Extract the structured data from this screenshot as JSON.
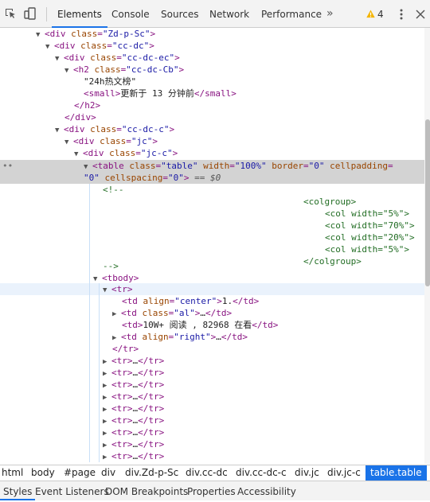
{
  "toolbar": {
    "tabs": [
      {
        "label": "Elements",
        "active": true
      },
      {
        "label": "Console"
      },
      {
        "label": "Sources"
      },
      {
        "label": "Network"
      },
      {
        "label": "Performance"
      }
    ],
    "more": "»",
    "warning_count": "4",
    "icons": [
      "inspect-icon",
      "device-toolbar-icon",
      "warning-icon",
      "kebab-menu-icon",
      "close-icon"
    ]
  },
  "dom": {
    "l1": {
      "open": "<",
      "tag": "div",
      "attr": "class",
      "val": "\"Zd-p-Sc\"",
      "close": ">"
    },
    "l2": {
      "open": "<",
      "tag": "div",
      "attr": "class",
      "val": "\"cc-dc\"",
      "close": ">"
    },
    "l3": {
      "open": "<",
      "tag": "div",
      "attr": "class",
      "val": "\"cc-dc-ec\"",
      "close": ">"
    },
    "l4": {
      "open": "<",
      "tag": "h2",
      "attr": "class",
      "val": "\"cc-dc-Cb\"",
      "close": ">"
    },
    "l5": {
      "text": "\"24h热文榜\""
    },
    "l6": {
      "open": "<small>",
      "text": "更新于 13 分钟前",
      "close": "</small>"
    },
    "l7": {
      "close": "</h2>"
    },
    "l8": {
      "close": "</div>"
    },
    "l9": {
      "open": "<",
      "tag": "div",
      "attr": "class",
      "val": "\"cc-dc-c\"",
      "close": ">"
    },
    "l10": {
      "open": "<",
      "tag": "div",
      "attr": "class",
      "val": "\"jc\"",
      "close": ">"
    },
    "l11": {
      "open": "<",
      "tag": "div",
      "attr": "class",
      "val": "\"jc-c\"",
      "close": ">"
    },
    "l12": {
      "open": "<",
      "tag": "table",
      "a1": "class",
      "v1": "\"table\"",
      "a2": "width",
      "v2": "\"100%\"",
      "a3": "border",
      "v3": "\"0\"",
      "a4": "cellpadding",
      "eq": "="
    },
    "l13": {
      "v4": "\"0\"",
      "a5": "cellspacing",
      "v5": "\"0\"",
      "close": ">",
      "suffix": "== $0"
    },
    "l14": {
      "text": "<!--"
    },
    "l15": {
      "text": "<colgroup>"
    },
    "l16": {
      "text": "<col width=\"5%\">"
    },
    "l17": {
      "text": "<col width=\"70%\">"
    },
    "l18": {
      "text": "<col width=\"20%\">"
    },
    "l19": {
      "text": "<col width=\"5%\">"
    },
    "l20": {
      "text": "</colgroup>"
    },
    "l21": {
      "text": "-->"
    },
    "l22": {
      "text": "<tbody>"
    },
    "l23": {
      "text": "<tr>"
    },
    "l24": {
      "open": "<",
      "tag": "td",
      "attr": "align",
      "val": "\"center\"",
      "gt": ">",
      "text": "1.",
      "close": "</td>"
    },
    "l25": {
      "open": "<",
      "tag": "td",
      "attr": "class",
      "val": "\"al\"",
      "gt": ">",
      "text": "…",
      "close": "</td>"
    },
    "l26": {
      "open": "<td>",
      "text": "10W+ 阅读 , 82968 在看",
      "close": "</td>"
    },
    "l27": {
      "open": "<",
      "tag": "td",
      "attr": "align",
      "val": "\"right\"",
      "gt": ">",
      "text": "…",
      "close": "</td>"
    },
    "l28": {
      "text": "</tr>"
    },
    "tr_collapsed": {
      "open": "<tr>",
      "text": "…",
      "close": "</tr>"
    }
  },
  "breadcrumbs": [
    "html",
    "body",
    "#page",
    "div",
    "div.Zd-p-Sc",
    "div.cc-dc",
    "div.cc-dc-c",
    "div.jc",
    "div.jc-c",
    "table.table"
  ],
  "bottom_tabs": [
    "Styles",
    "Event Listeners",
    "DOM Breakpoints",
    "Properties",
    "Accessibility"
  ],
  "colors": {
    "accent": "#1a73e8",
    "tag": "#881280",
    "attr_name": "#994500",
    "attr_value": "#1a1aa6",
    "comment": "#236e25"
  }
}
